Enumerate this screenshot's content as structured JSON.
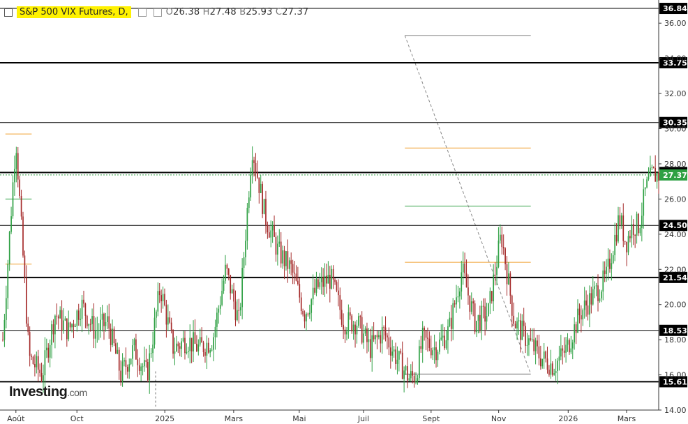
{
  "header": {
    "title": "S&P 500 VIX Futures, D,",
    "open_label": "O",
    "open": "26.38",
    "high_label": "H",
    "high": "27.48",
    "low_label": "B",
    "low": "25.93",
    "close_label": "C",
    "close": "27.37"
  },
  "logo": {
    "name": "Investing",
    "suffix": ".com"
  },
  "chart_data": {
    "type": "line",
    "title": "S&P 500 VIX Futures, D,",
    "xlabel": "",
    "ylabel": "",
    "ylim": [
      14.0,
      37.0
    ],
    "y_ticks": [
      "14.00",
      "16.00",
      "18.00",
      "20.00",
      "22.00",
      "24.00",
      "26.00",
      "28.00",
      "30.00",
      "32.00",
      "34.00",
      "36.00"
    ],
    "x_ticks": [
      {
        "label": "Août",
        "t": 0.02
      },
      {
        "label": "Oct",
        "t": 0.113
      },
      {
        "label": "2025",
        "t": 0.247
      },
      {
        "label": "Mars",
        "t": 0.352
      },
      {
        "label": "Mai",
        "t": 0.452
      },
      {
        "label": "Juil",
        "t": 0.55
      },
      {
        "label": "Sept",
        "t": 0.653
      },
      {
        "label": "Nov",
        "t": 0.756
      },
      {
        "label": "2026",
        "t": 0.862
      },
      {
        "label": "Mars",
        "t": 0.951
      }
    ],
    "horizontal_levels": [
      {
        "value": 36.84,
        "label": "36.84",
        "weight": "thin"
      },
      {
        "value": 33.75,
        "label": "33.75",
        "weight": "bold"
      },
      {
        "value": 30.35,
        "label": "30.35",
        "weight": "thin"
      },
      {
        "value": 27.51,
        "label": "27.51",
        "weight": "bold"
      },
      {
        "value": 24.5,
        "label": "24.50",
        "weight": "thin"
      },
      {
        "value": 21.54,
        "label": "21.54",
        "weight": "bold"
      },
      {
        "value": 18.53,
        "label": "18.53",
        "weight": "thin"
      },
      {
        "value": 15.61,
        "label": "15.61",
        "weight": "bold"
      }
    ],
    "current_price": {
      "value": 27.37,
      "label": "27.37",
      "color": "#2ea043"
    },
    "colors": {
      "up": "#2ea043",
      "down": "#a52a2a",
      "level": "#000000",
      "fib_orange": "#f0a030",
      "fib_green": "#2ea043",
      "trendline": "#888888"
    },
    "series": [
      {
        "t": [
          0.0,
          0.02,
          0.04,
          0.06,
          0.08,
          0.1,
          0.12,
          0.14,
          0.16,
          0.18,
          0.2,
          0.22,
          0.24,
          0.26,
          0.28,
          0.3,
          0.32,
          0.34,
          0.36,
          0.38,
          0.4,
          0.42,
          0.44,
          0.46,
          0.48,
          0.5,
          0.52,
          0.54,
          0.56,
          0.58,
          0.6,
          0.62,
          0.63,
          0.64,
          0.66,
          0.68,
          0.7,
          0.72,
          0.74,
          0.76,
          0.78,
          0.8,
          0.82,
          0.84,
          0.86,
          0.88,
          0.9,
          0.92,
          0.94,
          0.95,
          0.96,
          0.97,
          0.98,
          0.99
        ],
        "close": [
          18.0,
          29.5,
          17.0,
          16.0,
          19.5,
          18.5,
          20.0,
          18.5,
          19.0,
          16.0,
          17.5,
          16.0,
          21.0,
          17.5,
          18.0,
          17.5,
          18.0,
          22.0,
          19.0,
          29.0,
          25.0,
          23.0,
          22.0,
          19.5,
          21.0,
          21.5,
          19.0,
          19.0,
          17.5,
          18.5,
          17.0,
          15.8,
          16.0,
          18.0,
          17.5,
          18.5,
          22.0,
          19.0,
          19.5,
          24.0,
          19.0,
          18.0,
          17.0,
          16.5,
          17.5,
          19.5,
          20.5,
          21.5,
          25.0,
          23.5,
          24.5,
          24.5,
          26.5,
          27.37
        ]
      }
    ]
  }
}
